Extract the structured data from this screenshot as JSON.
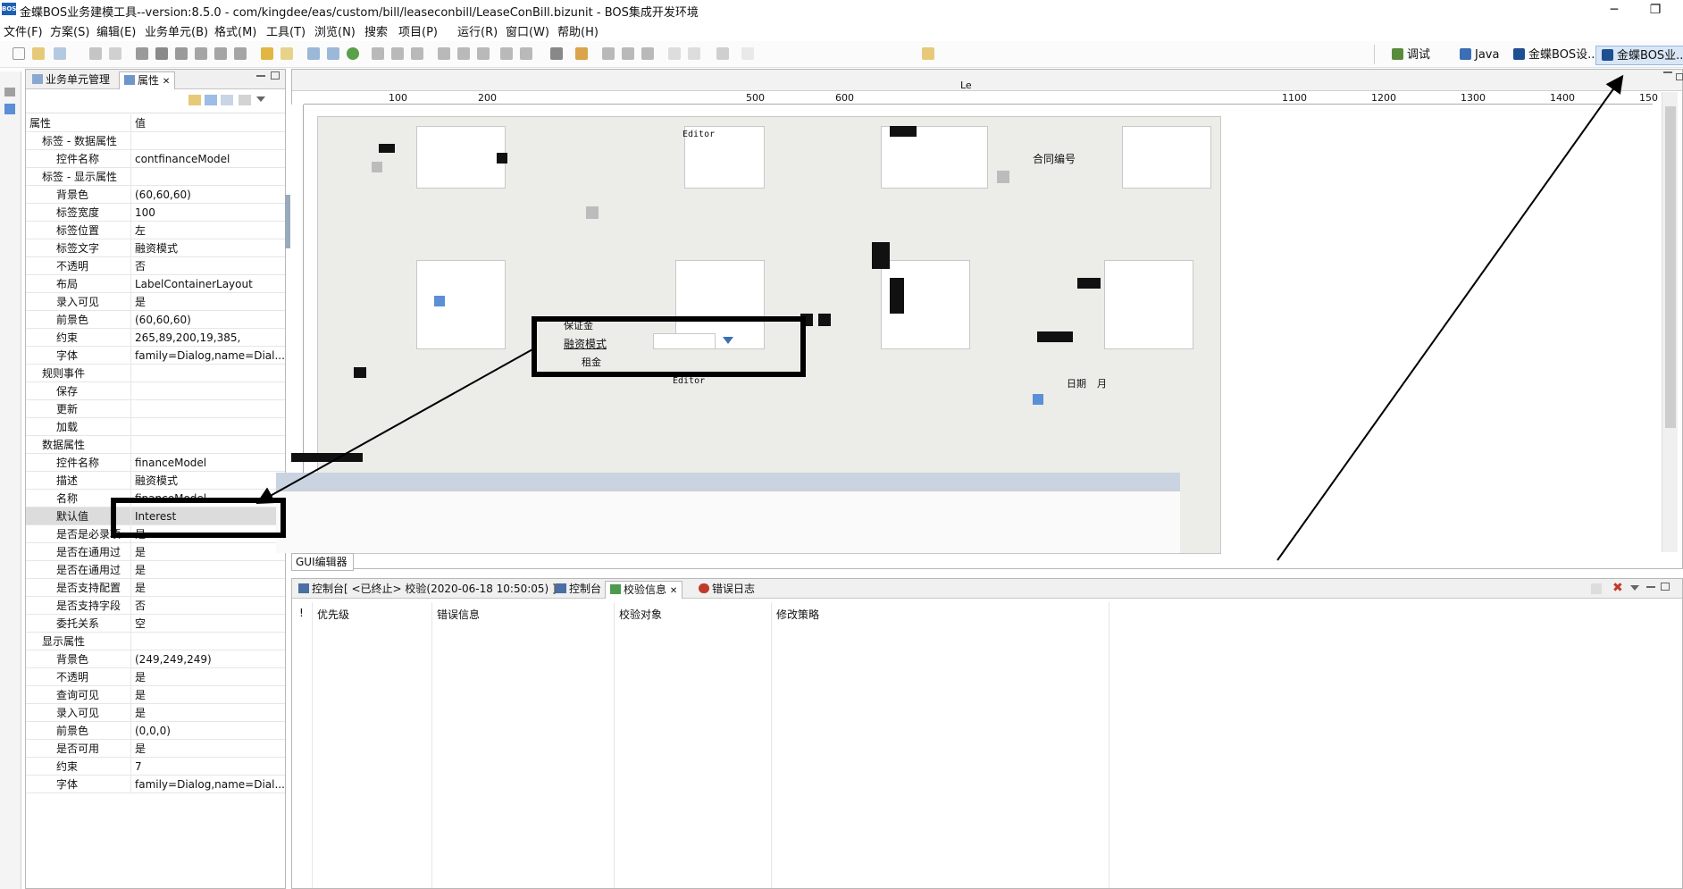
{
  "window": {
    "app_icon_text": "BOS",
    "title": "金蝶BOS业务建模工具--version:8.5.0  -  com/kingdee/eas/custom/bill/leaseconbill/LeaseConBill.bizunit  -  BOS集成开发环境",
    "minimize": "─",
    "restore": "❐"
  },
  "menu": [
    "文件(F)",
    "方案(S)",
    "编辑(E)",
    "业务单元(B)",
    "格式(M)",
    "工具(T)",
    "浏览(N)",
    "搜索",
    "项目(P)",
    "运行(R)",
    "窗口(W)",
    "帮助(H)"
  ],
  "perspectives": [
    {
      "label": "调试",
      "color": "#5a8b3c"
    },
    {
      "label": "Java",
      "color": "#3a6fb5"
    },
    {
      "label": "金蝶BOS设...",
      "color": "#1d4f91"
    },
    {
      "label": "金蝶BOS业...",
      "color": "#1d4f91",
      "active": true
    }
  ],
  "left_panel": {
    "tabs": [
      {
        "label": "业务单元管理"
      },
      {
        "label": "属性",
        "close": "✕"
      }
    ],
    "header": {
      "key": "属性",
      "value": "值"
    },
    "rows": [
      {
        "k": "标签 - 数据属性",
        "v": "",
        "indent": 1
      },
      {
        "k": "控件名称",
        "v": "contfinanceModel",
        "indent": 2
      },
      {
        "k": "标签 - 显示属性",
        "v": "",
        "indent": 1
      },
      {
        "k": "背景色",
        "v": "(60,60,60)",
        "indent": 2
      },
      {
        "k": "标签宽度",
        "v": "100",
        "indent": 2
      },
      {
        "k": "标签位置",
        "v": "左",
        "indent": 2
      },
      {
        "k": "标签文字",
        "v": "融资模式",
        "indent": 2
      },
      {
        "k": "不透明",
        "v": "否",
        "indent": 2
      },
      {
        "k": "布局",
        "v": "LabelContainerLayout",
        "indent": 2
      },
      {
        "k": "录入可见",
        "v": "是",
        "indent": 2
      },
      {
        "k": "前景色",
        "v": "(60,60,60)",
        "indent": 2
      },
      {
        "k": "约束",
        "v": "265,89,200,19,385,",
        "indent": 2
      },
      {
        "k": "字体",
        "v": "family=Dialog,name=Dial...",
        "indent": 2
      },
      {
        "k": "规则事件",
        "v": "",
        "indent": 1
      },
      {
        "k": "保存",
        "v": "",
        "indent": 2
      },
      {
        "k": "更新",
        "v": "",
        "indent": 2
      },
      {
        "k": "加载",
        "v": "",
        "indent": 2
      },
      {
        "k": "数据属性",
        "v": "",
        "indent": 1
      },
      {
        "k": "控件名称",
        "v": "financeModel",
        "indent": 2
      },
      {
        "k": "描述",
        "v": "融资模式",
        "indent": 2
      },
      {
        "k": "名称",
        "v": "financeModel",
        "indent": 2
      },
      {
        "k": "默认值",
        "v": "Interest",
        "indent": 2,
        "selected": true
      },
      {
        "k": "是否是必录项",
        "v": "是",
        "indent": 2
      },
      {
        "k": "是否在通用过",
        "v": "是",
        "indent": 2
      },
      {
        "k": "是否在通用过",
        "v": "是",
        "indent": 2
      },
      {
        "k": "是否支持配置",
        "v": "是",
        "indent": 2
      },
      {
        "k": "是否支持字段",
        "v": "否",
        "indent": 2
      },
      {
        "k": "委托关系",
        "v": "空",
        "indent": 2
      },
      {
        "k": "显示属性",
        "v": "",
        "indent": 1
      },
      {
        "k": "背景色",
        "v": "(249,249,249)",
        "indent": 2
      },
      {
        "k": "不透明",
        "v": "是",
        "indent": 2
      },
      {
        "k": "查询可见",
        "v": "是",
        "indent": 2
      },
      {
        "k": "录入可见",
        "v": "是",
        "indent": 2
      },
      {
        "k": "前景色",
        "v": "(0,0,0)",
        "indent": 2
      },
      {
        "k": "是否可用",
        "v": "是",
        "indent": 2
      },
      {
        "k": "约束",
        "v": "7",
        "indent": 2
      },
      {
        "k": "字体",
        "v": "family=Dialog,name=Dial...",
        "indent": 2
      }
    ]
  },
  "editor": {
    "palette_text": "Le",
    "ruler": [
      "100",
      "200",
      "500",
      "600",
      "1100",
      "1200",
      "1300",
      "1400",
      "150"
    ],
    "canvas_labels": {
      "editor1": "Editor",
      "editor2": "Editor",
      "hetong": "合同编号",
      "baozheng": "保证金",
      "rongzi": "融资模式",
      "zujin": "租金",
      "month": "月",
      "riqi": "日期"
    },
    "tab": "GUI编辑器"
  },
  "bottom": {
    "tabs": [
      {
        "label": "控制台[ <已终止> 校验(2020-06-18 10:50:05) ]"
      },
      {
        "label": "控制台"
      },
      {
        "label": "校验信息",
        "close": "✕",
        "active": true
      },
      {
        "label": "错误日志"
      }
    ],
    "columns": [
      "!",
      "优先级",
      "错误信息",
      "校验对象",
      "修改策略"
    ]
  },
  "colors": {
    "accent": "#1d5fb5",
    "selection": "#dcdcdc",
    "annotation": "#000000"
  }
}
